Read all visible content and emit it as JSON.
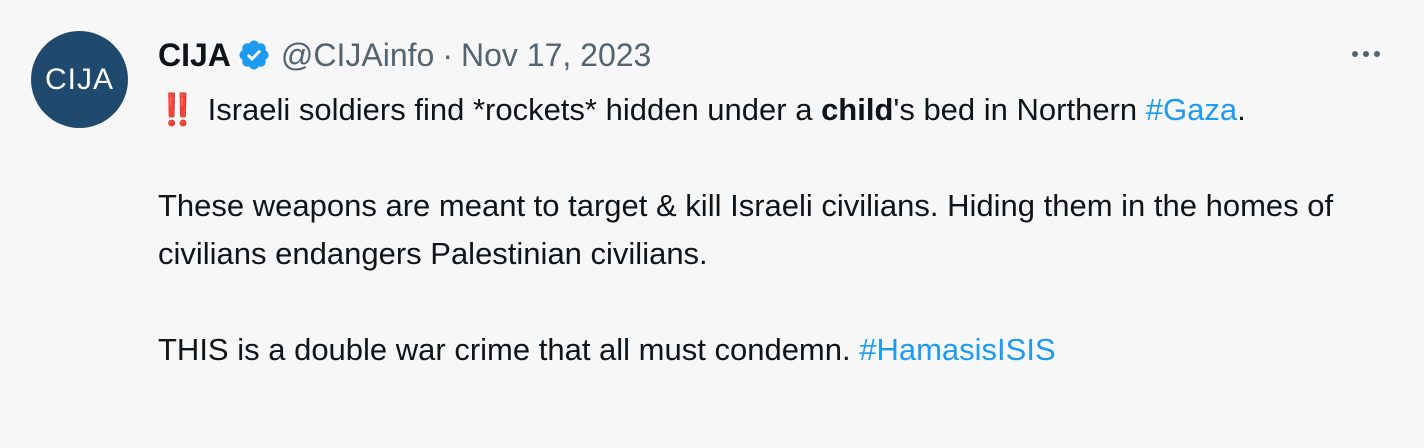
{
  "tweet": {
    "avatar_text": "CIJA",
    "display_name": "CIJA",
    "handle": "@CIJAinfo",
    "separator": "·",
    "date": "Nov 17, 2023",
    "more_icon": "more-horizontal-icon",
    "verified_icon": "verified-badge-icon",
    "emoji": "‼️",
    "line1_pre": "Israeli soldiers find *rockets* hidden under a ",
    "line1_bold": "child",
    "line1_post": "'s bed in Northern ",
    "hashtag1": "#Gaza",
    "line1_end": ".",
    "para2": "These weapons are meant to target & kill Israeli civilians. Hiding them in the homes of civilians endangers Palestinian civilians.",
    "para3": "THIS is a double war crime that all must condemn. ",
    "hashtag2": "#HamasisISIS"
  },
  "colors": {
    "background": "#f7f7f7",
    "text": "#0f1419",
    "secondary": "#536471",
    "link": "#1d9bf0",
    "verified": "#1d9bf0",
    "avatar_bg": "#1f4a6e"
  }
}
